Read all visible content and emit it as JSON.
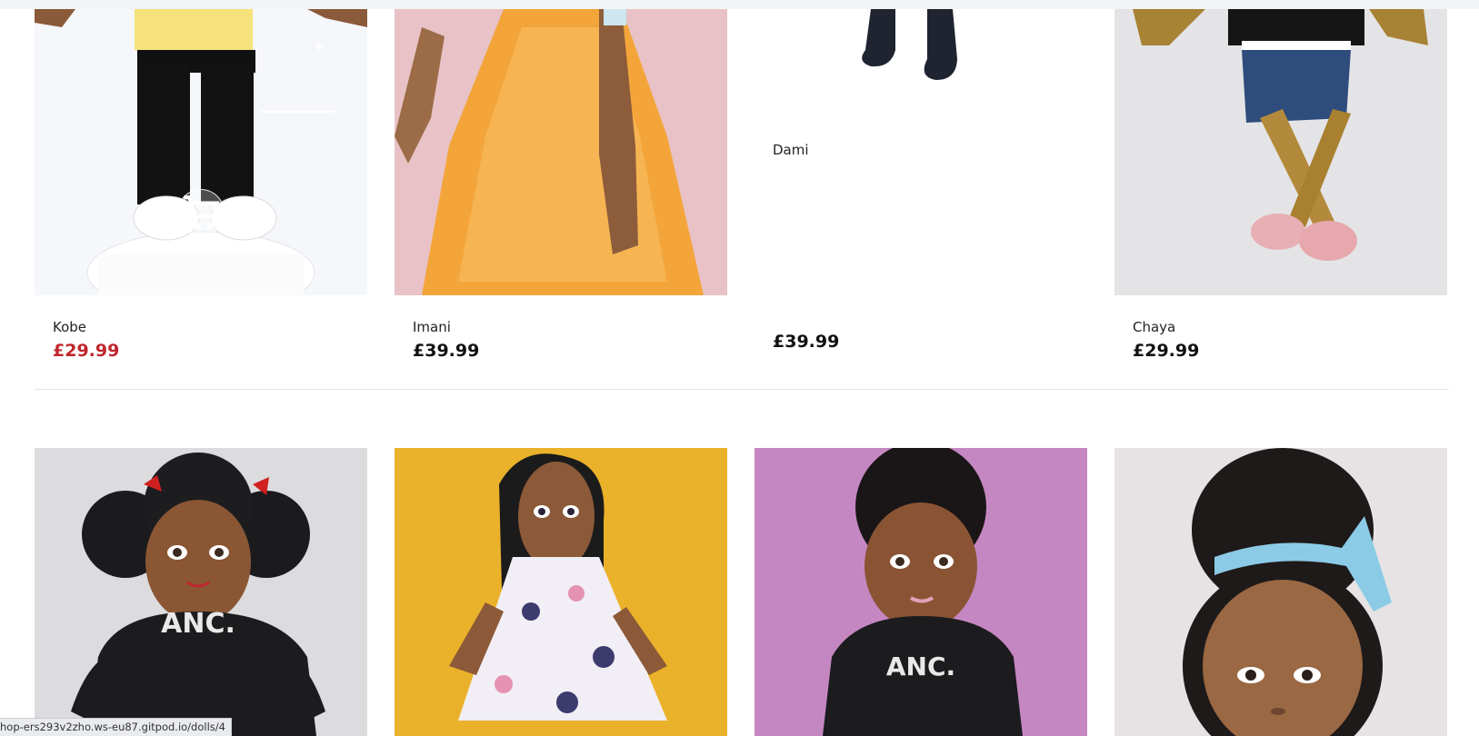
{
  "products_row1": [
    {
      "name": "Kobe",
      "price": "£29.99",
      "on_sale": true
    },
    {
      "name": "Imani",
      "price": "£39.99",
      "on_sale": false
    },
    {
      "name": "Dami",
      "price": "£39.99",
      "on_sale": false
    },
    {
      "name": "Chaya",
      "price": "£29.99",
      "on_sale": false
    }
  ],
  "products_row2": [
    {
      "hoodie_text": "ANC."
    },
    {
      "hoodie_text": ""
    },
    {
      "hoodie_text": "ANC."
    },
    {
      "hoodie_text": ""
    }
  ],
  "icons": {
    "add_to_cart": "cart-icon",
    "sparkle": "sparkle-icon"
  },
  "colors": {
    "sale_price": "#c0262d",
    "regular_price": "#111111"
  },
  "status_bar": {
    "url": "hop-ers293v2zho.ws-eu87.gitpod.io/dolls/4"
  }
}
